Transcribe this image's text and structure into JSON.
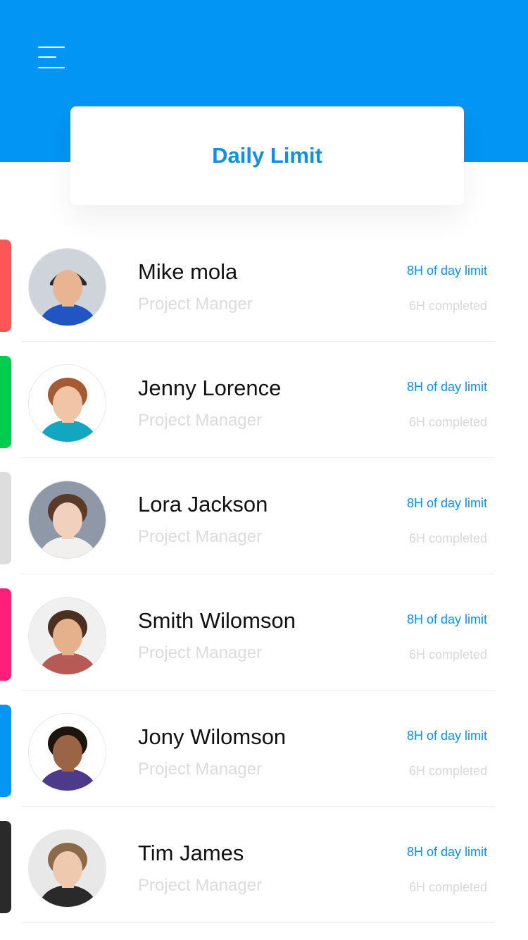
{
  "colors": {
    "header_bg": "#0295f3",
    "accent_blue": "#0f8fe6"
  },
  "header": {
    "menu_icon": "hamburger-menu-icon",
    "title": "Daily Limit"
  },
  "people": [
    {
      "name": "Mike mola",
      "role": "Project Manger",
      "limit": "8H of day limit",
      "completed": "6H completed",
      "accent": "#fc5656",
      "avatar": {
        "skin": "#e8b491",
        "hair": "#2a2a2a",
        "shirt": "#2155c4",
        "bg": "#cfd3da",
        "hat": true
      }
    },
    {
      "name": "Jenny Lorence",
      "role": "Project Manager",
      "limit": "8H of day limit",
      "completed": "6H completed",
      "accent": "#00cc4d",
      "avatar": {
        "skin": "#f0c4a4",
        "hair": "#a45a32",
        "shirt": "#12a6c0",
        "bg": "#ffffff",
        "hat": false
      }
    },
    {
      "name": "Lora Jackson",
      "role": "Project Manager",
      "limit": "8H of day limit",
      "completed": "6H completed",
      "accent": "#dddddd",
      "avatar": {
        "skin": "#f1d1bd",
        "hair": "#5a3a28",
        "shirt": "#f2f0ee",
        "bg": "#8f98a6",
        "hat": false
      }
    },
    {
      "name": "Smith Wilomson",
      "role": "Project Manager",
      "limit": "8H of day limit",
      "completed": "6H completed",
      "accent": "#ff1f7a",
      "avatar": {
        "skin": "#e5b08c",
        "hair": "#4b2f20",
        "shirt": "#b55a55",
        "bg": "#f0f0f0",
        "hat": false
      }
    },
    {
      "name": "Jony Wilomson",
      "role": "Project Manager",
      "limit": "8H of day limit",
      "completed": "6H completed",
      "accent": "#0595f2",
      "avatar": {
        "skin": "#9a6546",
        "hair": "#1e140e",
        "shirt": "#4d3a8a",
        "bg": "#ffffff",
        "hat": false
      }
    },
    {
      "name": "Tim James",
      "role": "Project Manager",
      "limit": "8H of day limit",
      "completed": "6H completed",
      "accent": "#2a2a2a",
      "avatar": {
        "skin": "#efc9ad",
        "hair": "#8a6a48",
        "shirt": "#2a2a2a",
        "bg": "#e8e8e8",
        "hat": false
      }
    }
  ]
}
